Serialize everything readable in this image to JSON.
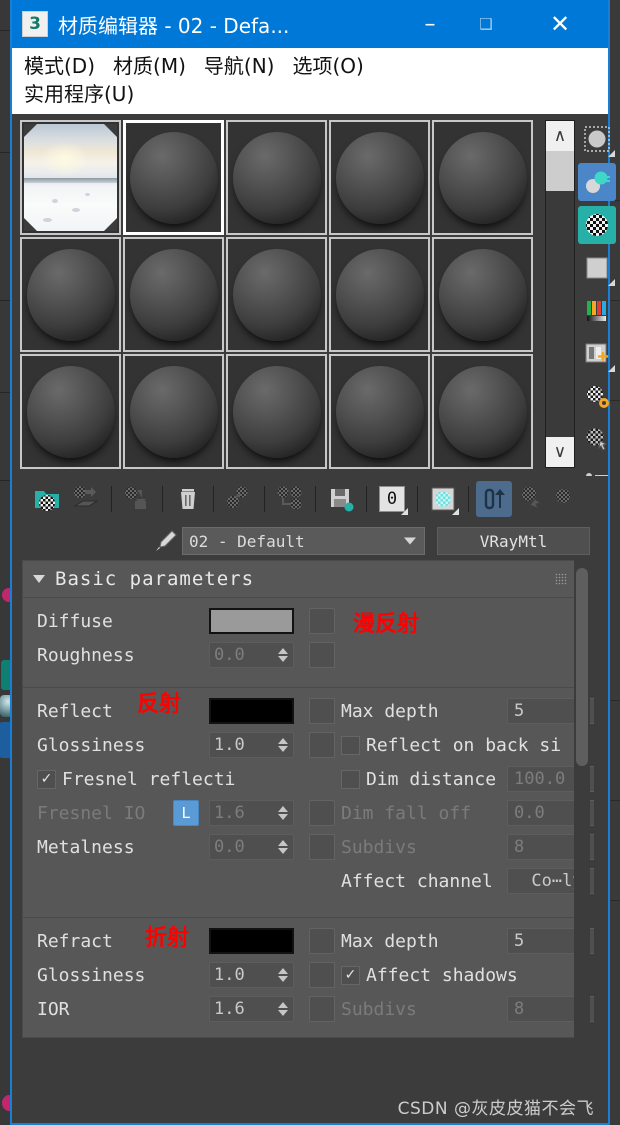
{
  "window": {
    "title": "材质编辑器 - 02 - Defa...",
    "app_icon": "3",
    "minimize": "–",
    "maximize": "❑",
    "close": "✕",
    "titlebar_color": "#0078d7",
    "border_color": "#1a7fd4"
  },
  "menubar": {
    "row1": [
      {
        "text": "模式(D)",
        "name": "menu-mode"
      },
      {
        "text": "材质(M)",
        "name": "menu-material"
      },
      {
        "text": "导航(N)",
        "name": "menu-navigation"
      },
      {
        "text": "选项(O)",
        "name": "menu-options"
      }
    ],
    "row2": [
      {
        "text": "实用程序(U)",
        "name": "menu-utilities"
      }
    ]
  },
  "slots": {
    "rows": 3,
    "cols": 5,
    "items": [
      {
        "index": 1,
        "type": "image",
        "selected": false,
        "label": "slot-01-snow-landscape"
      },
      {
        "index": 2,
        "type": "sphere",
        "selected": true,
        "label": "slot-02-default"
      },
      {
        "index": 3,
        "type": "sphere",
        "selected": false,
        "label": "slot-03"
      },
      {
        "index": 4,
        "type": "sphere",
        "selected": false,
        "label": "slot-04"
      },
      {
        "index": 5,
        "type": "sphere",
        "selected": false,
        "label": "slot-05"
      },
      {
        "index": 6,
        "type": "sphere",
        "selected": false,
        "label": "slot-06"
      },
      {
        "index": 7,
        "type": "sphere",
        "selected": false,
        "label": "slot-07"
      },
      {
        "index": 8,
        "type": "sphere",
        "selected": false,
        "label": "slot-08"
      },
      {
        "index": 9,
        "type": "sphere",
        "selected": false,
        "label": "slot-09"
      },
      {
        "index": 10,
        "type": "sphere",
        "selected": false,
        "label": "slot-10"
      },
      {
        "index": 11,
        "type": "sphere",
        "selected": false,
        "label": "slot-11"
      },
      {
        "index": 12,
        "type": "sphere",
        "selected": false,
        "label": "slot-12"
      },
      {
        "index": 13,
        "type": "sphere",
        "selected": false,
        "label": "slot-13"
      },
      {
        "index": 14,
        "type": "sphere",
        "selected": false,
        "label": "slot-14"
      },
      {
        "index": 15,
        "type": "sphere",
        "selected": false,
        "label": "slot-15"
      }
    ],
    "vscroll": {
      "up": "∧",
      "down": "∨"
    },
    "hscroll": {
      "left": "‹",
      "right": "›"
    }
  },
  "right_toolbar": [
    {
      "name": "sample-type-icon",
      "glyph": "●",
      "bg": "none"
    },
    {
      "name": "backlight-icon",
      "glyph": "●",
      "bg": "#4a86c8"
    },
    {
      "name": "background-checker-icon",
      "glyph": "●",
      "bg": "#26b0a8"
    },
    {
      "name": "sample-uv-tiling-icon",
      "glyph": "■",
      "bg": "none"
    },
    {
      "name": "video-color-check-icon",
      "glyph": "‖",
      "bg": "none"
    },
    {
      "name": "make-preview-icon",
      "glyph": "⊞",
      "bg": "none"
    },
    {
      "name": "options-icon",
      "glyph": "⚙",
      "bg": "none"
    },
    {
      "name": "select-by-material-icon",
      "glyph": "☚",
      "bg": "none"
    },
    {
      "name": "material-map-navigator-icon",
      "glyph": "≡",
      "bg": "none"
    }
  ],
  "mat_toolbar": [
    {
      "name": "get-material-button",
      "sep_after": false
    },
    {
      "name": "assign-material-to-selection-button",
      "sep_after": true
    },
    {
      "name": "show-in-viewport-button",
      "sep_after": true
    },
    {
      "name": "delete-material-button",
      "sep_after": true
    },
    {
      "name": "put-to-library-button",
      "sep_after": true
    },
    {
      "name": "make-material-copy-button",
      "sep_after": true
    },
    {
      "name": "save-material-button",
      "sep_after": true
    },
    {
      "name": "material-id-channel-button",
      "sep_after": true,
      "text": "0"
    },
    {
      "name": "show-shaded-material-button",
      "sep_after": true
    },
    {
      "name": "go-to-parent-button",
      "active": true,
      "sep_after": false
    },
    {
      "name": "go-forward-to-sibling-button",
      "sep_after": false
    },
    {
      "name": "pick-material-button",
      "sep_after": false
    }
  ],
  "material": {
    "eyedropper_name": "pick-material-from-object-icon",
    "name_value": "02 - Default",
    "type_button": "VRayMtl"
  },
  "params": {
    "rollout_title": "Basic parameters",
    "basic": {
      "diffuse_label": "Diffuse",
      "diffuse_color": "#9a9a9a",
      "roughness_label": "Roughness",
      "roughness_value": "0.0",
      "annotation": "漫反射"
    },
    "reflect": {
      "reflect_label": "Reflect",
      "reflect_color": "#000000",
      "annotation": "反射",
      "glossiness_label": "Glossiness",
      "glossiness_value": "1.0",
      "fresnel_label": "Fresnel reflecti",
      "fresnel_checked": true,
      "fresnel_ior_label": "Fresnel IO",
      "fresnel_ior_lock": "L",
      "fresnel_ior_value": "1.6",
      "metalness_label": "Metalness",
      "metalness_value": "0.0",
      "max_depth_label": "Max depth",
      "max_depth_value": "5",
      "reflect_back_label": "Reflect on back si",
      "reflect_back_checked": false,
      "dim_distance_label": "Dim distance",
      "dim_distance_value": "100.0",
      "dim_distance_checked": false,
      "dim_falloff_label": "Dim fall off",
      "dim_falloff_value": "0.0",
      "subdivs_label": "Subdivs",
      "subdivs_value": "8",
      "affect_channels_label": "Affect channel",
      "affect_channels_value": "Co⋯ly"
    },
    "refract": {
      "refract_label": "Refract",
      "refract_color": "#000000",
      "annotation": "折射",
      "glossiness_label": "Glossiness",
      "glossiness_value": "1.0",
      "ior_label": "IOR",
      "ior_value": "1.6",
      "max_depth_label": "Max depth",
      "max_depth_value": "5",
      "affect_shadows_label": "Affect shadows",
      "affect_shadows_checked": true,
      "subdivs_label": "Subdivs",
      "subdivs_value": "8"
    }
  },
  "watermark": "CSDN @灰皮皮猫不会飞"
}
